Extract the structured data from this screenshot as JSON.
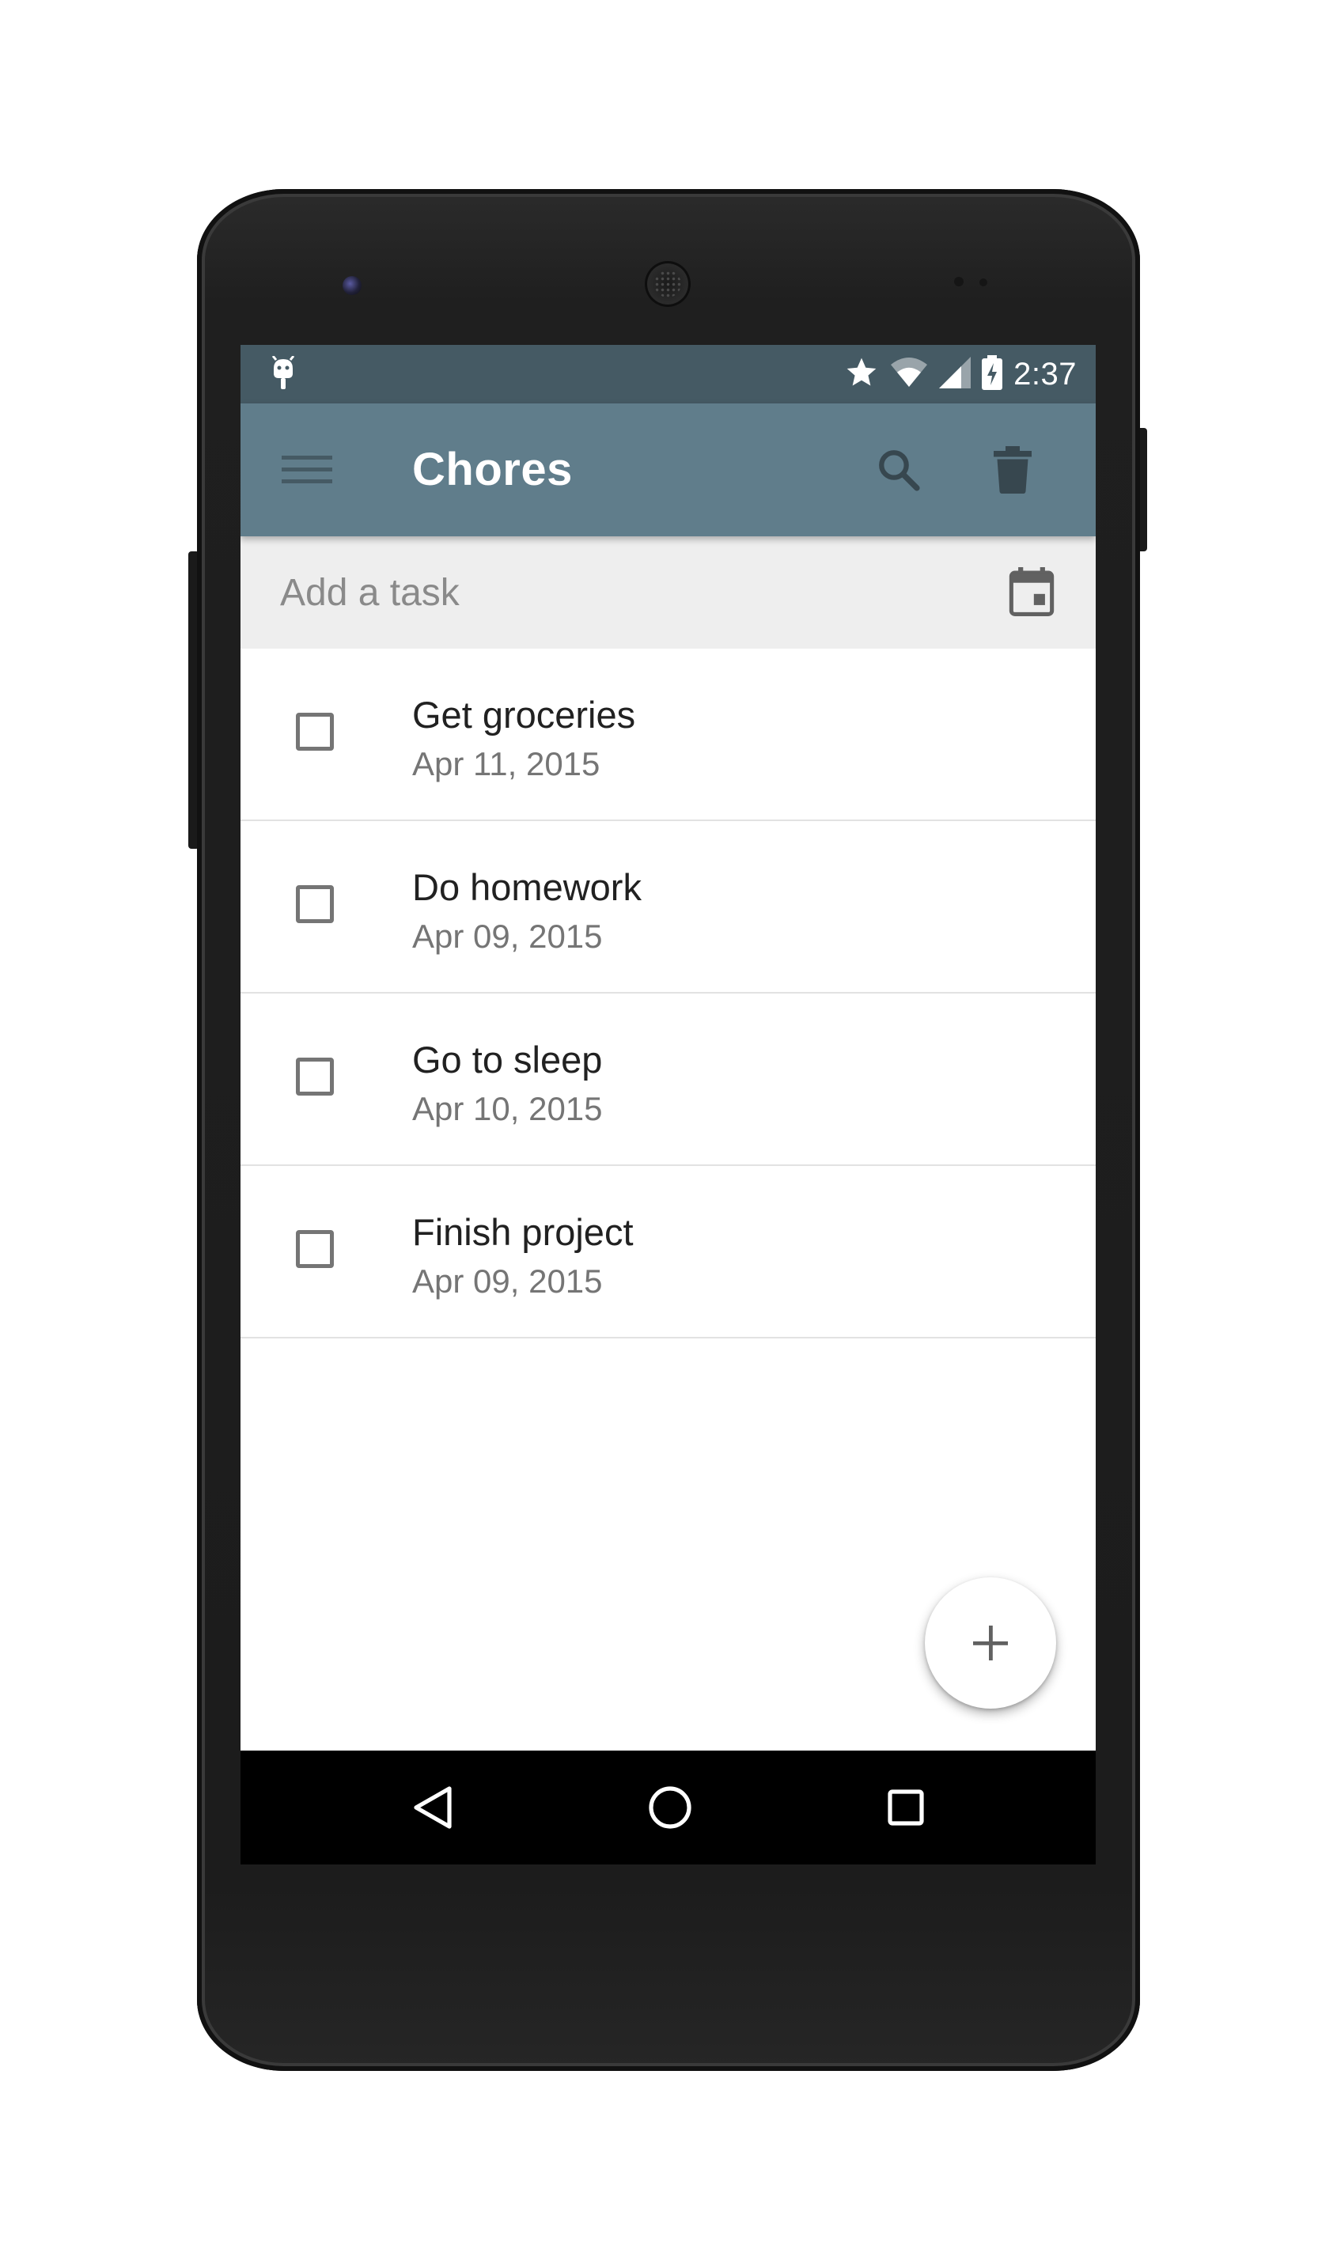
{
  "status_bar": {
    "time": "2:37",
    "icons": [
      "android-debug-icon",
      "star-icon",
      "wifi-icon",
      "cell-signal-icon",
      "battery-charging-icon"
    ]
  },
  "toolbar": {
    "title": "Chores",
    "menu_icon": "hamburger-menu-icon",
    "search_icon": "search-icon",
    "delete_icon": "trash-icon"
  },
  "add_task": {
    "placeholder": "Add a task",
    "value": "",
    "calendar_icon": "calendar-icon"
  },
  "tasks": [
    {
      "title": "Get groceries",
      "date": "Apr 11, 2015",
      "checked": false
    },
    {
      "title": "Do homework",
      "date": "Apr 09, 2015",
      "checked": false
    },
    {
      "title": "Go to sleep",
      "date": "Apr 10, 2015",
      "checked": false
    },
    {
      "title": "Finish project",
      "date": "Apr 09, 2015",
      "checked": false
    }
  ],
  "fab": {
    "icon": "plus-icon"
  },
  "nav_bar": {
    "icons": [
      "back-icon",
      "home-icon",
      "recents-icon"
    ]
  },
  "colors": {
    "status_bar": "#455a64",
    "toolbar": "#607d8b",
    "add_bar": "#eeeeee",
    "nav_bar": "#000000",
    "device": "#1c1c1c"
  }
}
